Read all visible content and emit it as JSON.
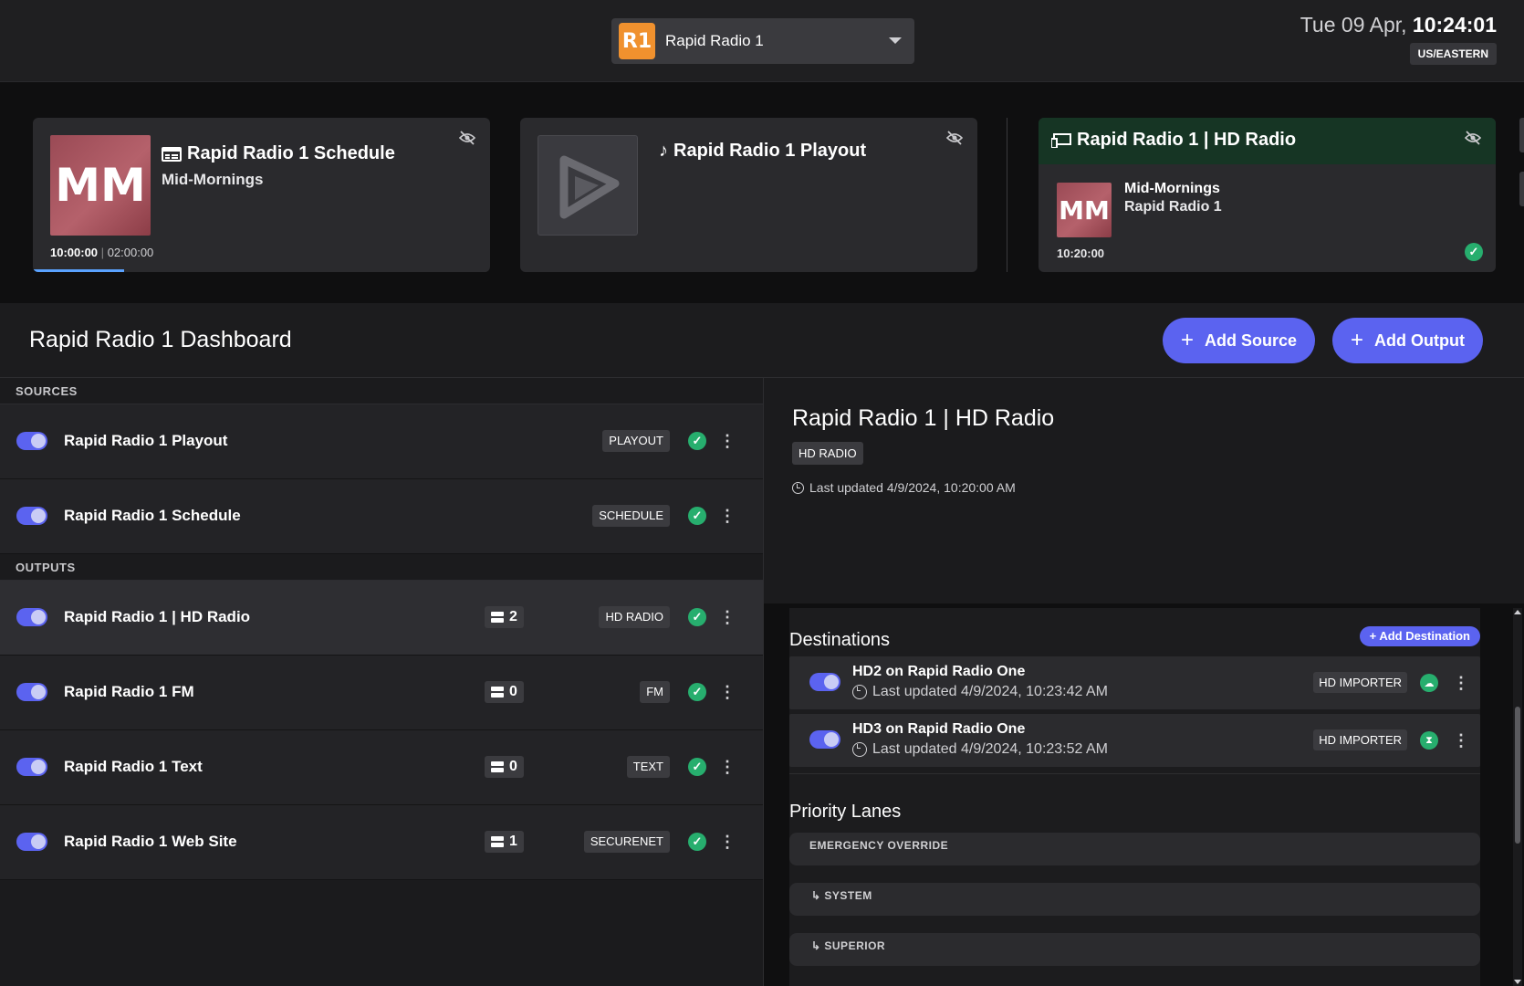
{
  "header": {
    "station_logo": "R1",
    "station_name": "Rapid Radio 1",
    "date": "Tue 09 Apr, ",
    "time": "10:24:01",
    "timezone": "US/EASTERN"
  },
  "cards": {
    "schedule": {
      "art": "MM",
      "title": "Rapid Radio 1 Schedule",
      "show": "Mid-Mornings",
      "start": "10:00:00",
      "separator": "|",
      "duration": "02:00:00",
      "progress": 0.2
    },
    "playout": {
      "title": "Rapid Radio 1 Playout"
    },
    "hd": {
      "title": "Rapid Radio 1 | HD Radio",
      "art": "MM",
      "show": "Mid-Mornings",
      "station": "Rapid Radio 1",
      "time": "10:20:00",
      "status_glyph": "✓"
    }
  },
  "dashboard": {
    "title": "Rapid Radio 1 Dashboard",
    "add_source": "Add Source",
    "add_output": "Add Output",
    "plus": "+"
  },
  "sources": {
    "label": "SOURCES",
    "items": [
      {
        "name": "Rapid Radio 1 Playout",
        "tag": "PLAYOUT"
      },
      {
        "name": "Rapid Radio 1 Schedule",
        "tag": "SCHEDULE"
      }
    ]
  },
  "outputs": {
    "label": "OUTPUTS",
    "items": [
      {
        "name": "Rapid Radio 1 | HD Radio",
        "count": "2",
        "tag": "HD RADIO"
      },
      {
        "name": "Rapid Radio 1 FM",
        "count": "0",
        "tag": "FM"
      },
      {
        "name": "Rapid Radio 1 Text",
        "count": "0",
        "tag": "TEXT"
      },
      {
        "name": "Rapid Radio 1 Web Site",
        "count": "1",
        "tag": "SECURENET"
      }
    ]
  },
  "detail": {
    "title": "Rapid Radio 1 | HD Radio",
    "tag": "HD RADIO",
    "updated": "Last updated 4/9/2024, 10:20:00 AM"
  },
  "destinations": {
    "title": "Destinations",
    "add_button": "+ Add Destination",
    "items": [
      {
        "name": "HD2 on Rapid Radio One",
        "updated": "Last updated 4/9/2024, 10:23:42 AM",
        "tag": "HD IMPORTER",
        "status_glyph": "☁"
      },
      {
        "name": "HD3 on Rapid Radio One",
        "updated": "Last updated 4/9/2024, 10:23:52 AM",
        "tag": "HD IMPORTER",
        "status_glyph": "⧗"
      }
    ]
  },
  "priority_lanes": {
    "title": "Priority Lanes",
    "items": [
      "EMERGENCY OVERRIDE",
      "↳ SYSTEM",
      "↳ SUPERIOR"
    ]
  },
  "glyphs": {
    "check": "✓",
    "kebab": "⋮",
    "hide": "⊘",
    "note": "♪"
  },
  "colors": {
    "accent": "#5b63f0",
    "ok": "#27ae6e",
    "station_logo": "#f0912e",
    "hd_header": "#163524"
  }
}
